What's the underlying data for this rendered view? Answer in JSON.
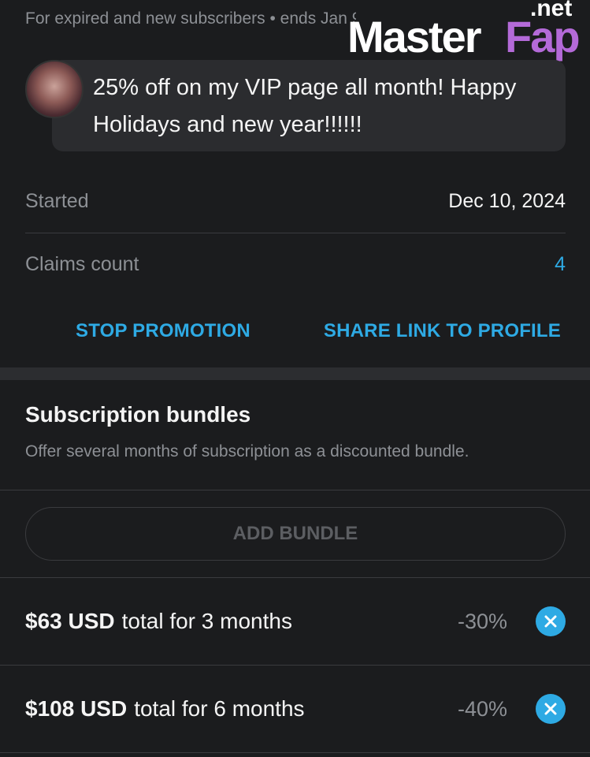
{
  "promotion": {
    "audience_text": "For expired and new subscribers  •  ends Jan 9  •  left 96",
    "message": "25% off on my VIP page all month! Happy Holidays and new year!!!!!!",
    "details": [
      {
        "label": "Started",
        "value": "Dec 10, 2024"
      },
      {
        "label": "Claims count",
        "value": "4"
      }
    ],
    "actions": {
      "stop": "STOP PROMOTION",
      "share": "SHARE LINK TO PROFILE"
    }
  },
  "watermark": {
    "master": "Master",
    "fap": "Fap",
    "net": ".net"
  },
  "bundles": {
    "title": "Subscription bundles",
    "description": "Offer several months of subscription as a discounted bundle.",
    "add_label": "ADD BUNDLE",
    "items": [
      {
        "price": "$63 USD",
        "rest": "total for 3 months",
        "discount": "-30%"
      },
      {
        "price": "$108 USD",
        "rest": "total for 6 months",
        "discount": "-40%"
      }
    ]
  },
  "colors": {
    "background": "#1b1c1e",
    "accent": "#2eaae4",
    "muted_text": "#8d9095",
    "bubble": "#2b2c2f"
  },
  "icons": {
    "remove": "close-circle-icon"
  }
}
